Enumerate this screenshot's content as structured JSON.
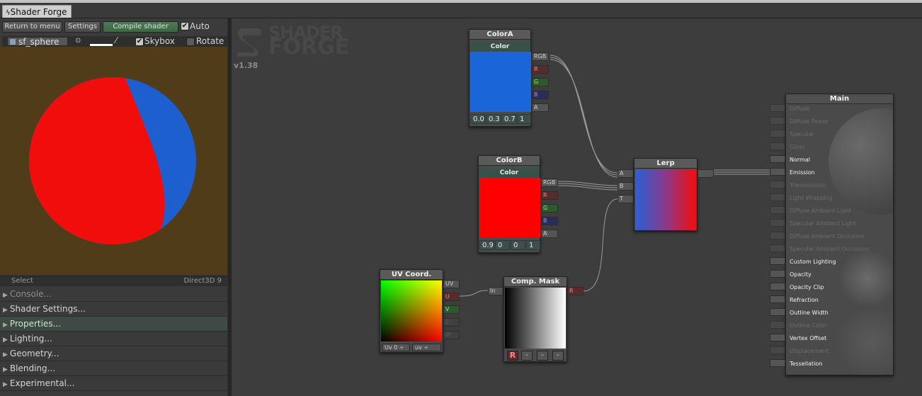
{
  "window": {
    "tab_label": "Shader Forge",
    "tab_icon": "shader-forge-icon"
  },
  "toolbar": {
    "return_label": "Return to menu",
    "settings_label": "Settings",
    "compile_label": "Compile shader",
    "auto_label": "Auto",
    "auto_checked": true
  },
  "preview_bar": {
    "mesh_name": "sf_sphere",
    "skybox_label": "Skybox",
    "skybox_checked": true,
    "rotate_label": "Rotate",
    "rotate_checked": false,
    "background_color": "#513c1a"
  },
  "status": {
    "select_label": "Select",
    "renderer_label": "Direct3D 9"
  },
  "sections": [
    {
      "label": "Console..."
    },
    {
      "label": "Shader Settings..."
    },
    {
      "label": "Properties..."
    },
    {
      "label": "Lighting..."
    },
    {
      "label": "Geometry..."
    },
    {
      "label": "Blending..."
    },
    {
      "label": "Experimental..."
    }
  ],
  "logo": {
    "line1": "SHADER",
    "line2": "FORGE",
    "version": "v1.38"
  },
  "nodes": {
    "colorA": {
      "property_name": "ColorA",
      "type_label": "Color",
      "swatch": "#1a66d9",
      "outputs": [
        "RGB",
        "R",
        "G",
        "B",
        "A"
      ],
      "values": [
        "0.0",
        "0.3",
        "0.7",
        "1"
      ]
    },
    "colorB": {
      "property_name": "ColorB",
      "type_label": "Color",
      "swatch": "#ff0000",
      "outputs": [
        "RGB",
        "R",
        "G",
        "B",
        "A"
      ],
      "values": [
        "0.9",
        "0",
        "0",
        "1"
      ]
    },
    "lerp": {
      "title": "Lerp",
      "inputs": [
        "A",
        "B",
        "T"
      ]
    },
    "uv": {
      "title": "UV Coord.",
      "outputs": [
        "UV",
        "U",
        "V",
        "Z",
        "W"
      ],
      "selector1": "Uv 0",
      "selector2": "uv"
    },
    "mask": {
      "title": "Comp. Mask",
      "input": "In",
      "output": "R",
      "channels": [
        "R",
        "-",
        "-",
        "-"
      ]
    },
    "main": {
      "title": "Main",
      "inputs": [
        {
          "label": "Diffuse",
          "active": false
        },
        {
          "label": "Diffuse Power",
          "active": false
        },
        {
          "label": "Specular",
          "active": false
        },
        {
          "label": "Gloss",
          "active": false
        },
        {
          "label": "Normal",
          "active": true
        },
        {
          "label": "Emission",
          "active": true
        },
        {
          "label": "Transmission",
          "active": false
        },
        {
          "label": "Light Wrapping",
          "active": false
        },
        {
          "label": "Diffuse Ambient Light",
          "active": false
        },
        {
          "label": "Specular Ambient Light",
          "active": false
        },
        {
          "label": "Diffuse Ambient Occlusion",
          "active": false
        },
        {
          "label": "Specular Ambient Occlusion",
          "active": false
        },
        {
          "label": "Custom Lighting",
          "active": true
        },
        {
          "label": "Opacity",
          "active": true
        },
        {
          "label": "Opacity Clip",
          "active": true
        },
        {
          "label": "Refraction",
          "active": true
        },
        {
          "label": "Outline Width",
          "active": true
        },
        {
          "label": "Outline Color",
          "active": false
        },
        {
          "label": "Vertex Offset",
          "active": true
        },
        {
          "label": "Displacement",
          "active": false
        },
        {
          "label": "Tessellation",
          "active": true
        }
      ]
    }
  }
}
